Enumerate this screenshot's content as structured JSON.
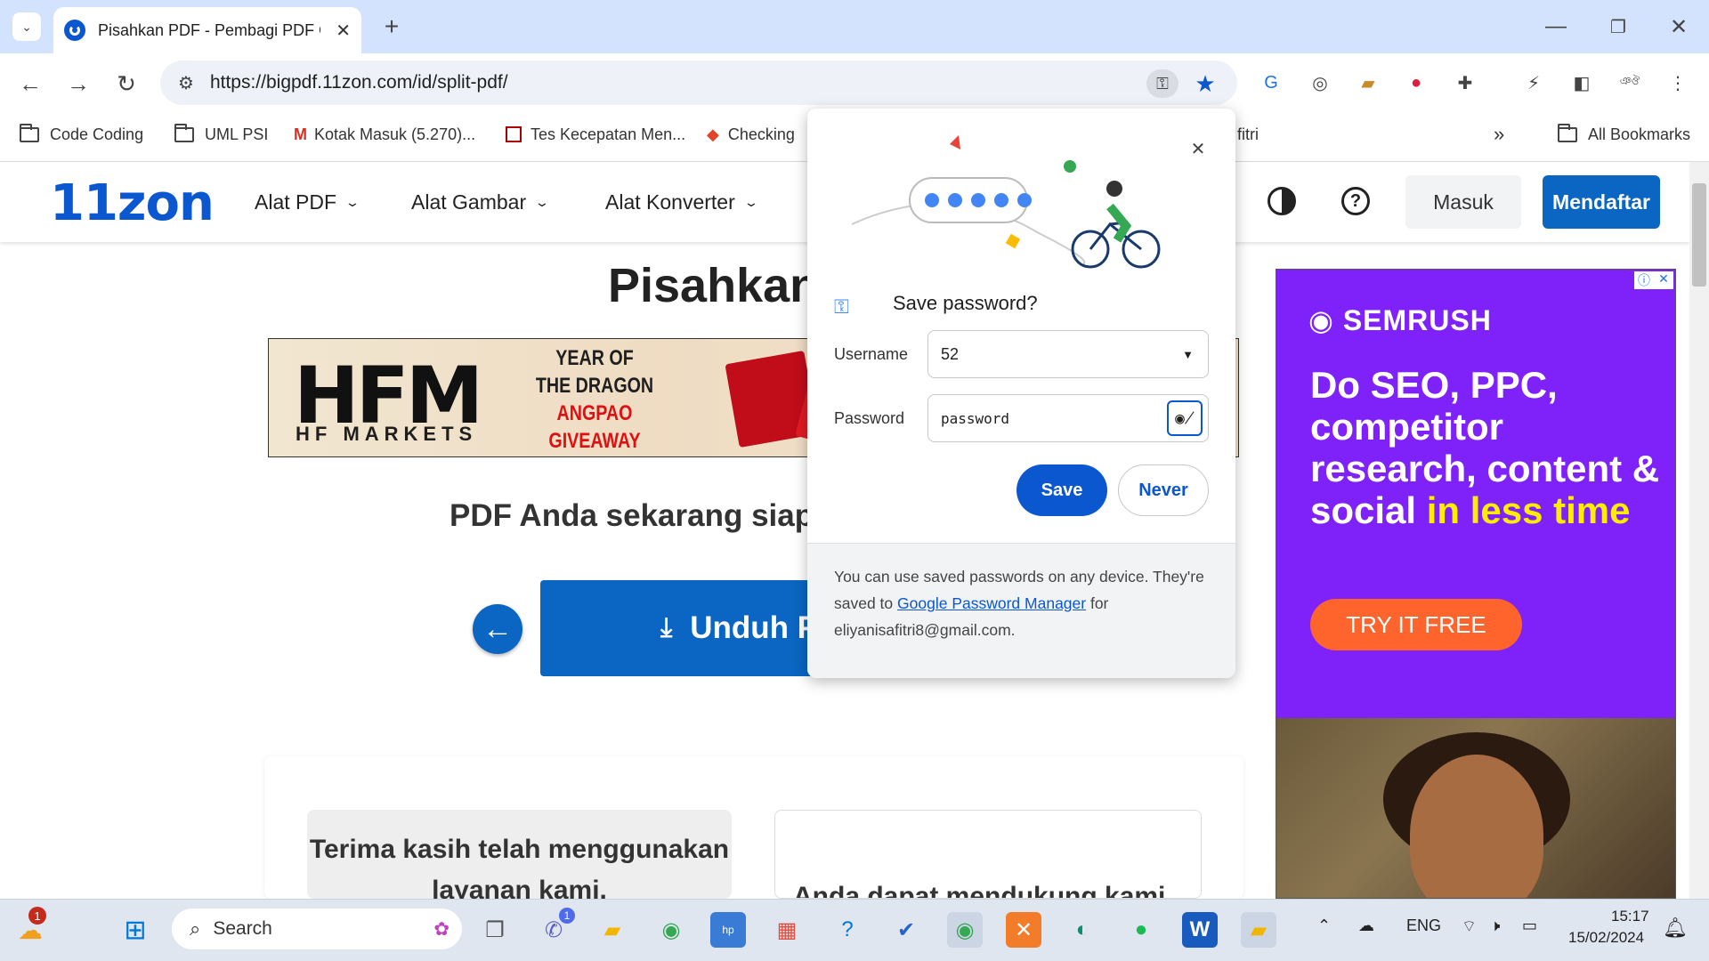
{
  "browser": {
    "tab_title": "Pisahkan PDF - Pembagi PDF Online",
    "url": "https://bigpdf.11zon.com/id/split-pdf/",
    "bookmarks": [
      {
        "label": "Code Coding",
        "icon": "folder-icon"
      },
      {
        "label": "UML PSI",
        "icon": "folder-icon"
      },
      {
        "label": "Kotak Masuk (5.270)...",
        "icon": "gmail-icon"
      },
      {
        "label": "Tes Kecepatan Men...",
        "icon": "speedtest-icon"
      },
      {
        "label": "Checking",
        "icon": "gitlab-icon"
      },
      {
        "label": "fitri",
        "icon": ""
      }
    ],
    "more_bookmarks": "»",
    "all_bookmarks": "All Bookmarks"
  },
  "site": {
    "logo": "11zon",
    "nav": [
      "Alat PDF",
      "Alat Gambar",
      "Alat Konverter"
    ],
    "login": "Masuk",
    "signup": "Mendaftar",
    "heading": "Pisahkan",
    "ready_text": "PDF Anda sekarang siap",
    "download_label": "Unduh P",
    "thanks_text": "Terima kasih telah menggunakan layanan kami.",
    "support_text": "Anda dapat mendukung kami"
  },
  "ad_banner": {
    "brand": "HFM",
    "brand_sub": "HF MARKETS",
    "line1": "YEAR OF",
    "line2": "THE DRAGON",
    "line3": "ANGPAO",
    "line4": "GIVEAWAY"
  },
  "side_ad": {
    "brand": "SEMRUSH",
    "headline_white": "Do SEO, PPC, competitor research, content & social",
    "headline_yellow": "in less time",
    "cta": "TRY IT FREE"
  },
  "password_popup": {
    "title": "Save password?",
    "username_label": "Username",
    "username_value": "52",
    "password_label": "Password",
    "password_value": "password",
    "save": "Save",
    "never": "Never",
    "footer_pre": "You can use saved passwords on any device. They're saved to ",
    "footer_link": "Google Password Manager",
    "footer_post": " for eliyanisafitri8@gmail.com."
  },
  "taskbar": {
    "search_placeholder": "Search",
    "language": "ENG",
    "time": "15:17",
    "date": "15/02/2024",
    "weather_badge": "1",
    "teams_badge": "1"
  },
  "colors": {
    "accent": "#0b57d0",
    "site_blue": "#0a66c2",
    "semrush_purple": "#7e22f9",
    "cta_orange": "#ff642d"
  }
}
